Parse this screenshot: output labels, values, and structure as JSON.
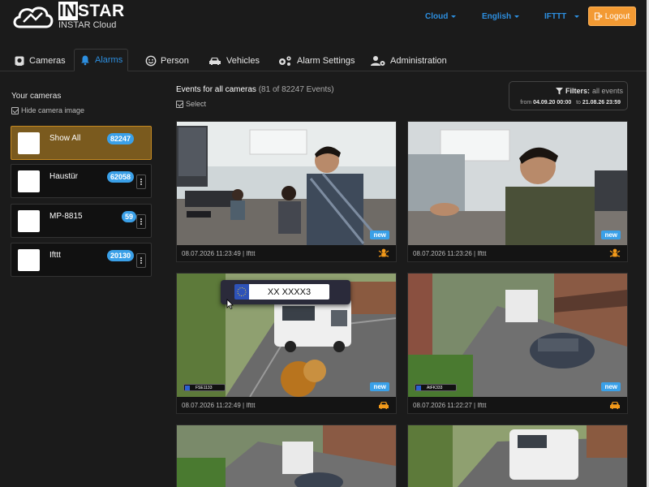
{
  "header": {
    "brand": "INSTAR",
    "subtitle": "INSTAR Cloud",
    "nav": [
      "Cloud",
      "English",
      "IFTTT"
    ],
    "logout_label": "Logout"
  },
  "tabs": [
    {
      "label": "Cameras",
      "icon": "camera-icon"
    },
    {
      "label": "Alarms",
      "icon": "bell-icon",
      "active": true
    },
    {
      "label": "Person",
      "icon": "smiley-icon"
    },
    {
      "label": "Vehicles",
      "icon": "car-icon"
    },
    {
      "label": "Alarm Settings",
      "icon": "gears-icon"
    },
    {
      "label": "Administration",
      "icon": "user-gear-icon"
    }
  ],
  "sidebar": {
    "title": "Your cameras",
    "hide_image_label": "Hide camera image",
    "cameras": [
      {
        "name": "Show All",
        "count": "82247",
        "active": true
      },
      {
        "name": "Haustür",
        "count": "62058"
      },
      {
        "name": "MP-8815",
        "count": "59"
      },
      {
        "name": "Ifttt",
        "count": "20130"
      }
    ]
  },
  "events": {
    "title": "Events for all cameras",
    "count_text": "(81 of 82247 Events)",
    "select_label": "Select",
    "filters_label": "Filters:",
    "filters_value": "all events",
    "from_label": "from",
    "from_value": "04.09.20 00:00",
    "to_label": "to",
    "to_value": "21.08.26 23:59",
    "popup_plate": "XX XXXX3",
    "cards": [
      {
        "timestamp": "08.07.2026 11:23:49 | Ifttt",
        "badge": "new",
        "type": "person",
        "plate": ""
      },
      {
        "timestamp": "08.07.2026 11:23:26 | Ifttt",
        "badge": "new",
        "type": "person",
        "plate": ""
      },
      {
        "timestamp": "08.07.2026 11:22:49 | Ifttt",
        "badge": "new",
        "type": "vehicle",
        "plate": "FSE1133"
      },
      {
        "timestamp": "08.07.2026 11:22:27 | Ifttt",
        "badge": "new",
        "type": "vehicle",
        "plate": "AtFK333"
      }
    ]
  },
  "colors": {
    "accent": "#2d8fe0",
    "logout": "#f39a33",
    "active_camera": "#7a5a1e",
    "badge": "#3aa0e8",
    "alarm_icon": "#f39a1a"
  }
}
